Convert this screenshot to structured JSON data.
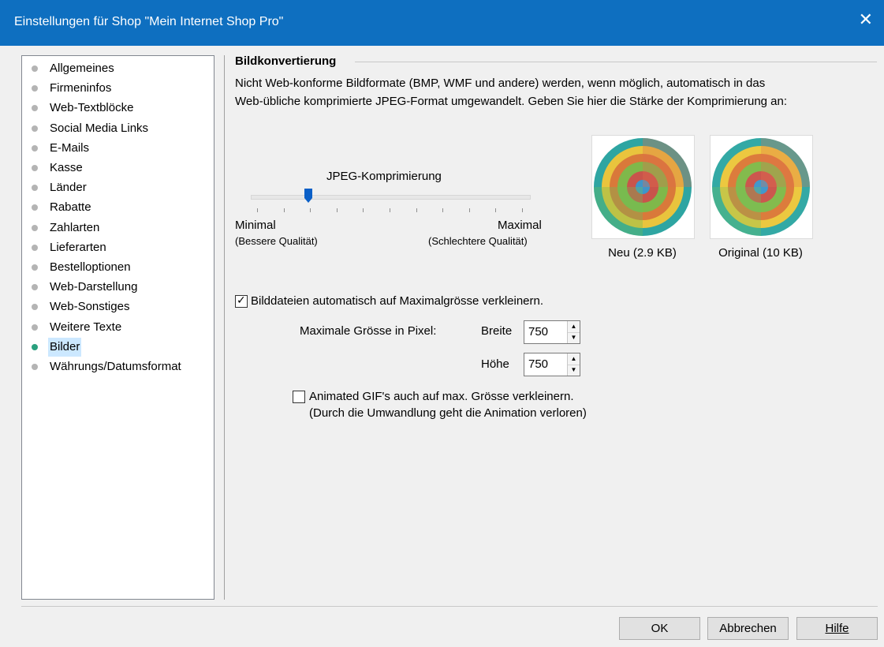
{
  "window": {
    "title": "Einstellungen für Shop \"Mein Internet Shop Pro\"",
    "close_icon": "close-icon",
    "close_glyph": "✕"
  },
  "sidebar": {
    "items": [
      {
        "label": "Allgemeines",
        "active": false
      },
      {
        "label": "Firmeninfos",
        "active": false
      },
      {
        "label": "Web-Textblöcke",
        "active": false
      },
      {
        "label": "Social Media Links",
        "active": false
      },
      {
        "label": "E-Mails",
        "active": false
      },
      {
        "label": "Kasse",
        "active": false
      },
      {
        "label": "Länder",
        "active": false
      },
      {
        "label": "Rabatte",
        "active": false
      },
      {
        "label": "Zahlarten",
        "active": false
      },
      {
        "label": "Lieferarten",
        "active": false
      },
      {
        "label": "Bestelloptionen",
        "active": false
      },
      {
        "label": "Web-Darstellung",
        "active": false
      },
      {
        "label": "Web-Sonstiges",
        "active": false
      },
      {
        "label": "Weitere Texte",
        "active": false
      },
      {
        "label": "Bilder",
        "active": true
      },
      {
        "label": "Währungs/Datumsformat",
        "active": false
      }
    ]
  },
  "main": {
    "group_title": "Bildkonvertierung",
    "description_line1": "Nicht Web-konforme Bildformate (BMP, WMF und andere) werden, wenn möglich, automatisch in das",
    "description_line2": "Web-übliche komprimierte JPEG-Format umgewandelt. Geben Sie hier die Stärke der Komprimierung an:",
    "slider": {
      "label": "JPEG-Komprimierung",
      "min_label": "Minimal",
      "min_sub": "(Bessere Qualität)",
      "max_label": "Maximal",
      "max_sub": "(Schlechtere Qualität)",
      "value": 2,
      "max": 10
    },
    "preview_new_caption": "Neu (2.9 KB)",
    "preview_original_caption": "Original (10 KB)",
    "auto_resize": {
      "checked": true,
      "label": "Bilddateien automatisch auf Maximalgrösse verkleinern."
    },
    "max_size_label": "Maximale Grösse in Pixel:",
    "width_label": "Breite",
    "width_value": "750",
    "height_label": "Höhe",
    "height_value": "750",
    "animated_gif": {
      "checked": false,
      "label_line1": "Animated GIF's auch auf max. Grösse verkleinern.",
      "label_line2": "(Durch die Umwandlung geht die Animation verloren)"
    }
  },
  "buttons": {
    "ok": "OK",
    "cancel": "Abbrechen",
    "help": "Hilfe"
  },
  "colors": {
    "titlebar": "#0e6fc0",
    "active_bullet": "#2aa07e",
    "selection": "#cce8ff",
    "slider_thumb": "#0a5fc7"
  }
}
